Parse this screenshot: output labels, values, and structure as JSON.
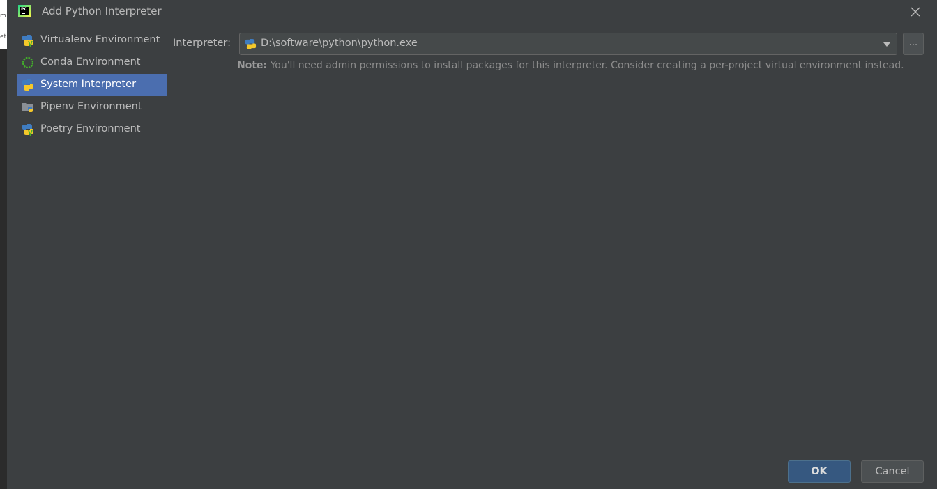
{
  "window": {
    "title": "Add Python Interpreter",
    "logo_text": "PC"
  },
  "background_fragments": [
    "m",
    "et"
  ],
  "sidebar": {
    "items": [
      {
        "label": "Virtualenv Environment",
        "icon": "virtualenv-icon",
        "selected": false
      },
      {
        "label": "Conda Environment",
        "icon": "conda-icon",
        "selected": false
      },
      {
        "label": "System Interpreter",
        "icon": "python-icon",
        "selected": true
      },
      {
        "label": "Pipenv Environment",
        "icon": "pipenv-icon",
        "selected": false
      },
      {
        "label": "Poetry Environment",
        "icon": "poetry-icon",
        "selected": false
      }
    ]
  },
  "interpreter": {
    "label": "Interpreter:",
    "value": "D:\\software\\python\\python.exe",
    "browse_label": "..."
  },
  "note": {
    "prefix": "Note:",
    "text": " You'll need admin permissions to install packages for this interpreter. Consider creating a per-project virtual environment instead."
  },
  "buttons": {
    "ok": "OK",
    "cancel": "Cancel"
  },
  "colors": {
    "dialog_bg": "#3c3f41",
    "selection": "#4b6eaf",
    "ok_button": "#365880",
    "python_blue": "#3f7cc0",
    "python_yellow": "#f5c82a",
    "conda_green": "#43b02a"
  }
}
